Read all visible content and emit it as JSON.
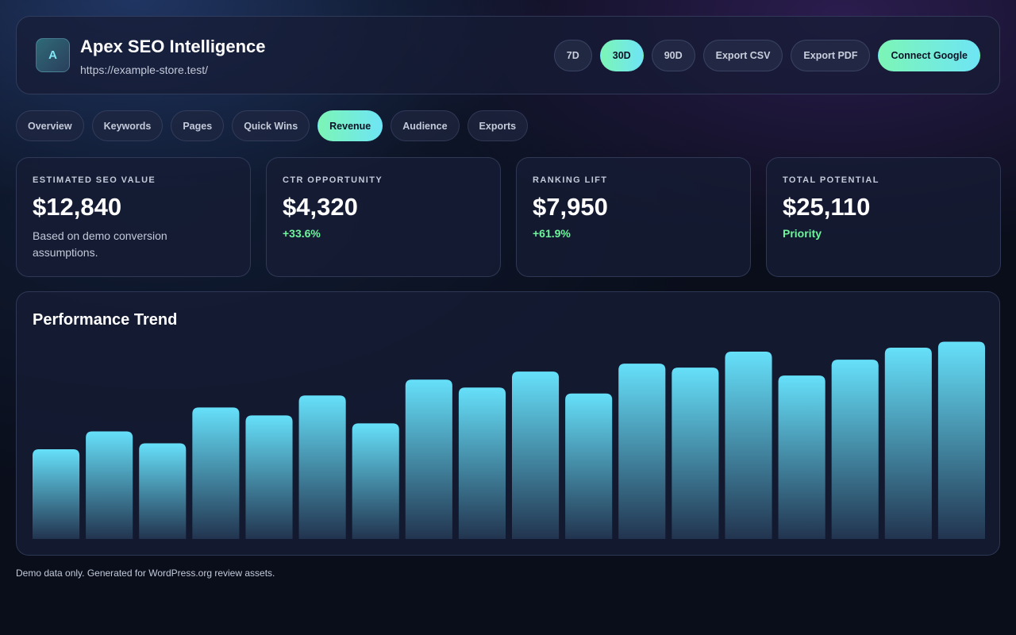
{
  "header": {
    "logo_letter": "A",
    "title": "Apex SEO Intelligence",
    "url": "https://example-store.test/",
    "range_buttons": [
      {
        "label": "7D",
        "active": false
      },
      {
        "label": "30D",
        "active": true
      },
      {
        "label": "90D",
        "active": false
      }
    ],
    "export_csv_label": "Export CSV",
    "export_pdf_label": "Export PDF",
    "connect_label": "Connect Google"
  },
  "tabs": [
    {
      "label": "Overview",
      "active": false
    },
    {
      "label": "Keywords",
      "active": false
    },
    {
      "label": "Pages",
      "active": false
    },
    {
      "label": "Quick Wins",
      "active": false
    },
    {
      "label": "Revenue",
      "active": true
    },
    {
      "label": "Audience",
      "active": false
    },
    {
      "label": "Exports",
      "active": false
    }
  ],
  "cards": [
    {
      "label": "Estimated SEO Value",
      "value": "$12,840",
      "desc": "Based on demo conversion assumptions.",
      "delta": ""
    },
    {
      "label": "CTR Opportunity",
      "value": "$4,320",
      "desc": "",
      "delta": "+33.6%"
    },
    {
      "label": "Ranking Lift",
      "value": "$7,950",
      "desc": "",
      "delta": "+61.9%"
    },
    {
      "label": "Total Potential",
      "value": "$25,110",
      "desc": "",
      "delta": "Priority"
    }
  ],
  "chart": {
    "title": "Performance Trend"
  },
  "chart_data": {
    "type": "bar",
    "title": "Performance Trend",
    "categories": [],
    "values": [
      45,
      54,
      48,
      66,
      62,
      72,
      58,
      80,
      76,
      84,
      73,
      88,
      86,
      94,
      82,
      90,
      96,
      99
    ],
    "ylim": [
      0,
      100
    ],
    "grid": false,
    "legend": "none",
    "bar_color_top": "#66e0fa",
    "bar_color_bottom": "#22344f"
  },
  "footer": {
    "text": "Demo data only. Generated for WordPress.org review assets."
  },
  "colors": {
    "accent_start": "#7cf5b6",
    "accent_end": "#6ee5f5",
    "positive": "#6ef59c",
    "background": "#0a0e1b"
  }
}
